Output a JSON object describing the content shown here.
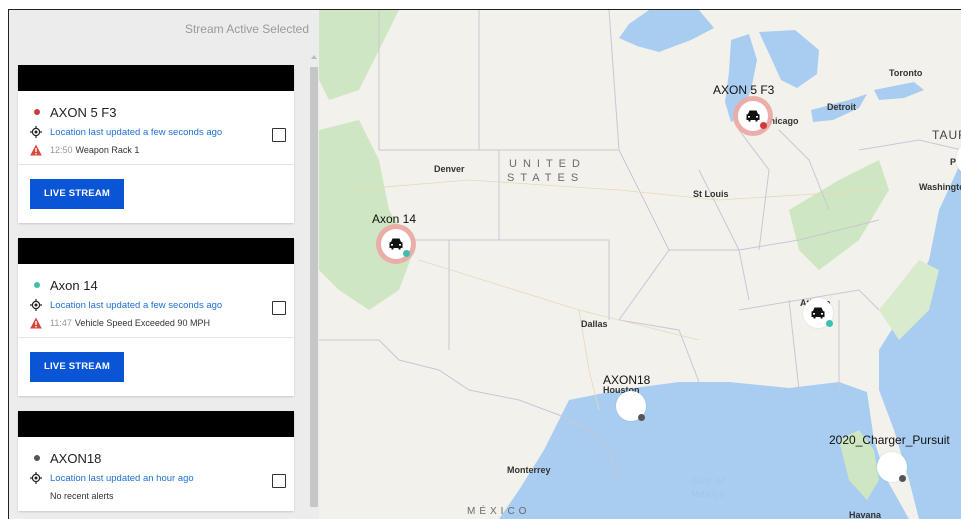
{
  "sidebar": {
    "header": "Stream Active Selected",
    "cards": [
      {
        "unit": "AXON 5 F3",
        "status_color": "#d03a3a",
        "location": "Location last updated a few seconds ago",
        "alert_time": "12:50",
        "alert_text": "Weapon Rack 1",
        "has_alert": true,
        "button": "LIVE STREAM"
      },
      {
        "unit": "Axon 14",
        "status_color": "#3cbfae",
        "location": "Location last updated a few seconds ago",
        "alert_time": "11:47",
        "alert_text": "Vehicle Speed Exceeded 90 MPH",
        "has_alert": true,
        "button": "LIVE STREAM"
      },
      {
        "unit": "AXON18",
        "status_color": "#555555",
        "location": "Location last updated an hour ago",
        "alert_time": "",
        "alert_text": "No recent alerts",
        "has_alert": false
      }
    ]
  },
  "map": {
    "labels": {
      "toronto": "Toronto",
      "detroit": "Detroit",
      "taurus": "TAURU",
      "p": "P",
      "washington": "Washingto",
      "denver": "Denver",
      "united": "UNITED",
      "states": "STATES",
      "st_louis": "St Louis",
      "dallas": "Dallas",
      "houston": "Houston",
      "monterrey": "Monterrey",
      "gulf": "Gulf of",
      "mexico_water": "Mexico",
      "mexico": "MÉXICO",
      "havana": "Havana",
      "atlanta": "Atlanta",
      "chicago": "Chicago"
    },
    "markers": [
      {
        "label": "AXON 5 F3",
        "dot": "#d03a3a"
      },
      {
        "label": "Axon 14",
        "dot": "#3cbfae"
      },
      {
        "label": "",
        "dot": "#3cbfae"
      },
      {
        "label": "AXON18",
        "dot": "#555555"
      },
      {
        "label": "2020_Charger_Pursuit",
        "dot": "#555555"
      }
    ]
  },
  "colors": {
    "accent": "#0a55d6",
    "water": "#a9cdf0",
    "land": "#f3f1ec",
    "park": "#cfe6c2"
  }
}
